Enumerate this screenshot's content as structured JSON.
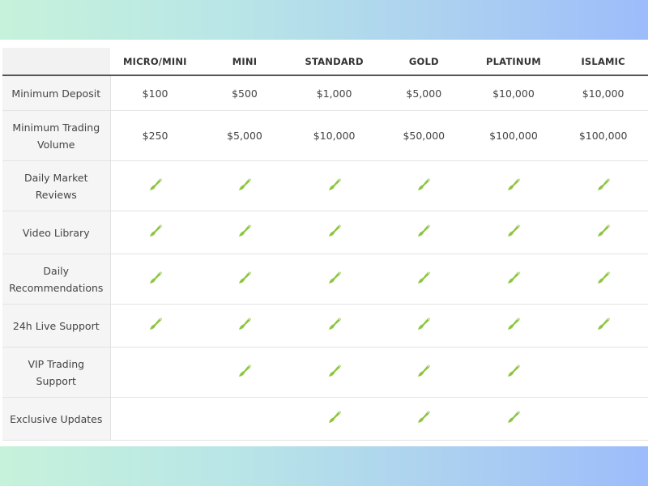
{
  "colors": {
    "accent": "#8cc63f",
    "gradient_start": "#c6f2db",
    "gradient_end": "#9cbcfb"
  },
  "table": {
    "columns": [
      "MICRO/MINI",
      "MINI",
      "STANDARD",
      "GOLD",
      "PLATINUM",
      "ISLAMIC"
    ],
    "rows": [
      {
        "label": "Minimum Deposit",
        "cells": [
          "$100",
          "$500",
          "$1,000",
          "$5,000",
          "$10,000",
          "$10,000"
        ]
      },
      {
        "label": "Minimum Trading Volume",
        "cells": [
          "$250",
          "$5,000",
          "$10,000",
          "$50,000",
          "$100,000",
          "$100,000"
        ]
      },
      {
        "label": "Daily Market Reviews",
        "checks": [
          true,
          true,
          true,
          true,
          true,
          true
        ]
      },
      {
        "label": "Video Library",
        "checks": [
          true,
          true,
          true,
          true,
          true,
          true
        ]
      },
      {
        "label": "Daily Recommendations",
        "checks": [
          true,
          true,
          true,
          true,
          true,
          true
        ]
      },
      {
        "label": "24h Live Support",
        "checks": [
          true,
          true,
          true,
          true,
          true,
          true
        ]
      },
      {
        "label": "VIP Trading Support",
        "checks": [
          false,
          true,
          true,
          true,
          true,
          false
        ]
      },
      {
        "label": "Exclusive Updates",
        "checks": [
          false,
          false,
          true,
          true,
          true,
          false
        ]
      }
    ],
    "check_icon": "check-icon"
  }
}
